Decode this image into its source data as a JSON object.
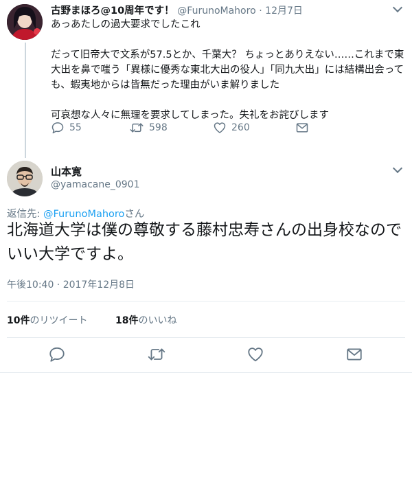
{
  "tweet1": {
    "display_name": "古野まほろ@10周年です！",
    "handle": "@FurunoMahoro",
    "date": "12月7日",
    "paragraphs": [
      "あっあたしの過大要求でしたこれ",
      "だって旧帝大で文系が57.5とか、千葉大？ ちょっとありえない……これまで東大出を鼻で嗤う「異様に優秀な東北大出の役人」「同九大出」には結構出会っても、蝦夷地からは皆無だった理由がいま解りました",
      "可哀想な人々に無理を要求してしまった。失礼をお詫びします"
    ],
    "replies": "55",
    "retweets": "598",
    "likes": "260"
  },
  "tweet2": {
    "display_name": "山本寛",
    "handle": "@yamacane_0901",
    "reply_prefix": "返信先: ",
    "reply_handle": "@FurunoMahoro",
    "reply_suffix": "さん",
    "text": "北海道大学は僕の尊敬する藤村忠寿さんの出身校なのでいい大学ですよ。",
    "timestamp": "午後10:40 · 2017年12月8日",
    "retweet_count": "10件",
    "retweet_label": "のリツイート",
    "like_count": "18件",
    "like_label": "のいいね"
  },
  "colors": {
    "accent": "#1da1f2",
    "secondary_text": "#657786",
    "divider": "#e6ecf0"
  },
  "icons": [
    "reply-icon",
    "retweet-icon",
    "like-icon",
    "dm-icon",
    "chevron-down-icon"
  ]
}
